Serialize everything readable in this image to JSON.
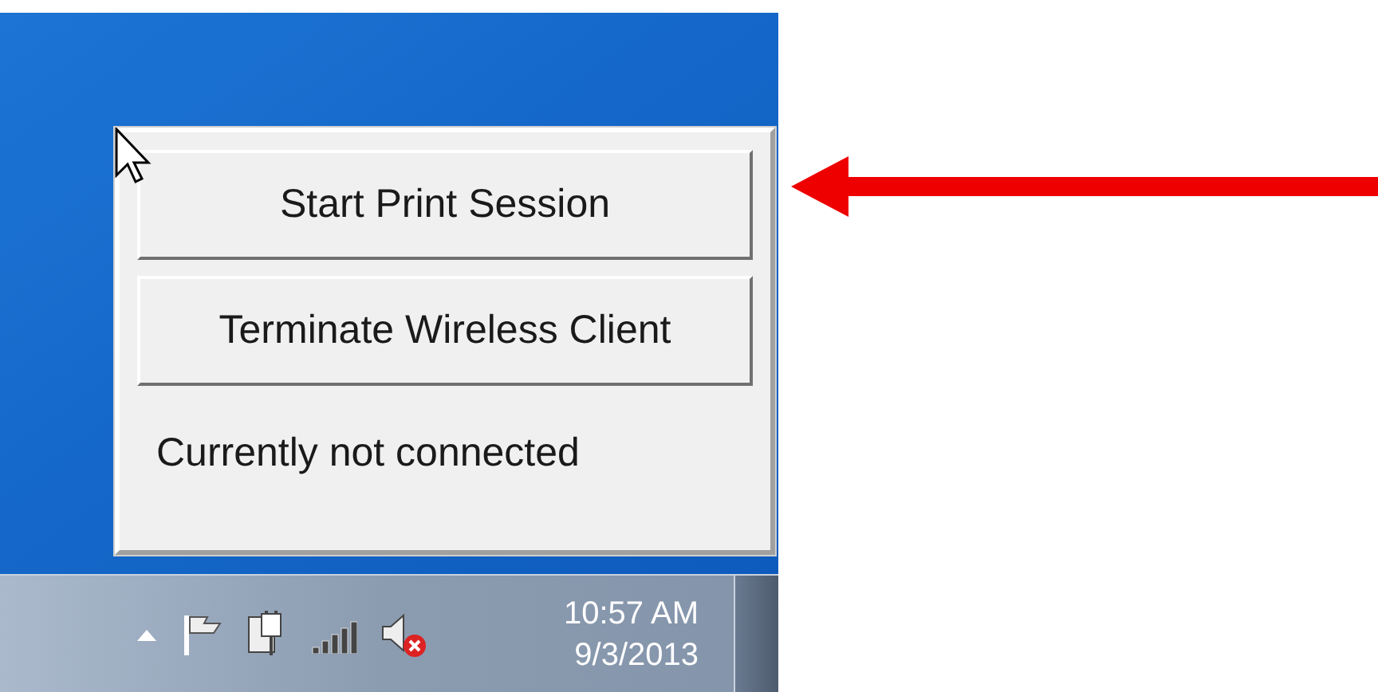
{
  "popup": {
    "buttons": [
      {
        "label": "Start Print Session"
      },
      {
        "label": "Terminate Wireless Client"
      }
    ],
    "status": "Currently not connected"
  },
  "taskbar": {
    "time": "10:57 AM",
    "date": "9/3/2013"
  }
}
